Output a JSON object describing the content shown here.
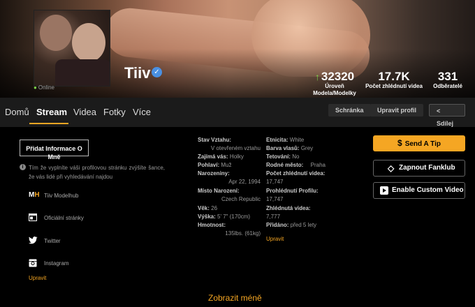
{
  "profile": {
    "online_label": "Online",
    "username": "Tiiv",
    "verified_glyph": "✓"
  },
  "stats": [
    {
      "value": "32320",
      "label": "Úroveň Modela/Modelky"
    },
    {
      "value": "17.7K",
      "label": "Počet zhlédnutí videa"
    },
    {
      "value": "331",
      "label": "Odběratelé"
    }
  ],
  "nav": {
    "tabs": [
      "Domů",
      "Stream",
      "Videa",
      "Fotky",
      "Více"
    ],
    "active_tab": "Stream",
    "buttons": {
      "screen": "Schránka",
      "edit": "Upravit profil",
      "share": "Sdílej"
    }
  },
  "left": {
    "add_info_button": "Přidat Informace O Mně",
    "hint": "Tím že vyplníte váši profilovou stránku zvýšíte šance, že vás lidé při vyhledávání najdou",
    "social": [
      {
        "icon": "modelhub-icon",
        "label": "Tiiv Modelhub"
      },
      {
        "icon": "website-icon",
        "label": "Oficiální stránky"
      },
      {
        "icon": "twitter-icon",
        "label": "Twitter"
      },
      {
        "icon": "instagram-icon",
        "label": "Instagram"
      }
    ],
    "edit_link": "Upravit"
  },
  "details_left": [
    {
      "key": "Stav Vztahu:",
      "value": "V otevřeném vztahu"
    },
    {
      "key": "Zajímá vás:",
      "value": "Holky"
    },
    {
      "key": "Pohlaví:",
      "value": "Muž"
    },
    {
      "key": "Narozeniny:",
      "value": "Apr 22, 1994"
    },
    {
      "key": "Místo Narození:",
      "value": "Czech Republic"
    },
    {
      "key": "Věk:",
      "value": "26"
    },
    {
      "key": "Výška:",
      "value": "5' 7\" (170cm)"
    },
    {
      "key": "Hmotnost:",
      "value": "135lbs. (61kg)"
    }
  ],
  "details_right": [
    {
      "key": "Etnicita:",
      "value": "White"
    },
    {
      "key": "Barva vlasů:",
      "value": "Grey"
    },
    {
      "key": "Tetování:",
      "value": "No"
    },
    {
      "key": "Rodné město:",
      "value": "Praha"
    },
    {
      "key": "Počet zhlédnutí videa:",
      "value": "17,747"
    },
    {
      "key": "Prohlédnutí Profilu:",
      "value": "17,747"
    },
    {
      "key": "Zhlédnutá videa:",
      "value": "7,777"
    },
    {
      "key": "Přidáno:",
      "value": "před 5 lety"
    }
  ],
  "details_edit_link": "Upravit",
  "actions": {
    "tip": "Send A Tip",
    "fanclub": "Zapnout Fanklub",
    "custom_video": "Enable Custom Video"
  },
  "show_less": "Zobrazit méně",
  "colors": {
    "accent": "#f5a623",
    "online": "#7bd148",
    "verified": "#4a90e2"
  }
}
